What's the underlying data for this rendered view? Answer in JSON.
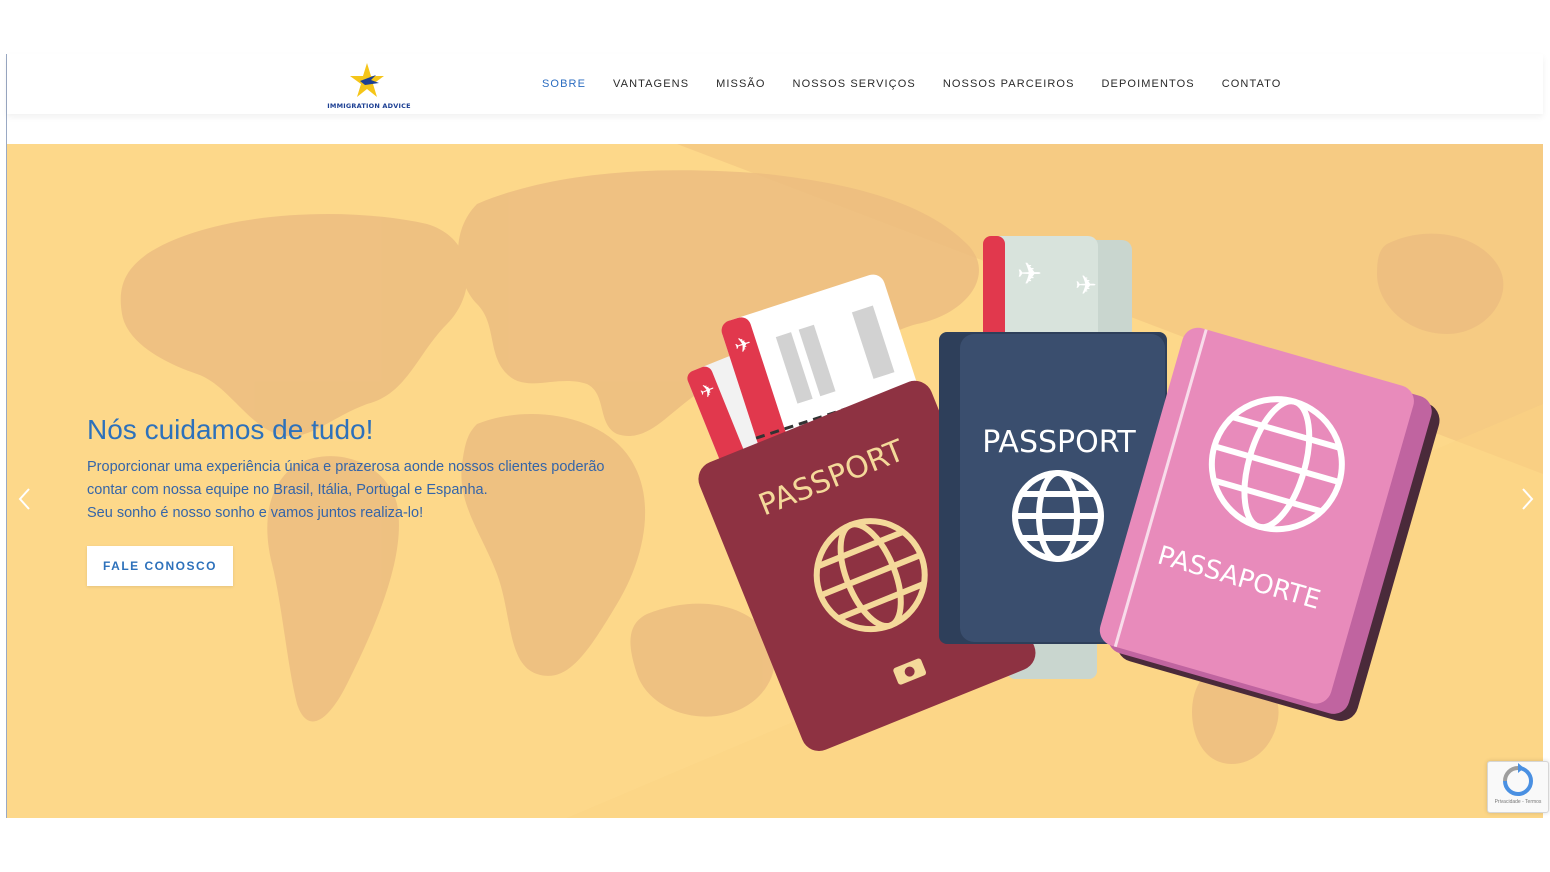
{
  "header": {
    "logo_text": "IMMIGRATION ADVICE",
    "nav": [
      {
        "label": "SOBRE",
        "active": true
      },
      {
        "label": "VANTAGENS",
        "active": false
      },
      {
        "label": "MISSÃO",
        "active": false
      },
      {
        "label": "NOSSOS SERVIÇOS",
        "active": false
      },
      {
        "label": "NOSSOS PARCEIROS",
        "active": false
      },
      {
        "label": "DEPOIMENTOS",
        "active": false
      },
      {
        "label": "CONTATO",
        "active": false
      }
    ]
  },
  "hero": {
    "title": "Nós cuidamos de tudo!",
    "description_lines": [
      "Proporcionar uma experiência única e prazerosa aonde nossos clientes poderão",
      "contar com nossa equipe no Brasil, Itália, Portugal e Espanha.",
      "Seu sonho é nosso sonho e vamos juntos realiza-lo!"
    ],
    "cta_label": "FALE CONOSCO",
    "passport_labels": [
      "PASSPORT",
      "PASSPORT",
      "PASSAPORTE"
    ]
  },
  "recaptcha": {
    "text": "Privacidade - Termos"
  },
  "colors": {
    "accent": "#2d71bb",
    "hero_bg": "#fdd88a",
    "passport_red": "#8e3242",
    "passport_blue": "#3a4e6e",
    "passport_pink": "#e88bbb",
    "logo_star": "#f5c518",
    "logo_text": "#1c3f93"
  },
  "icons": [
    "star-logo-icon",
    "chevron-left-icon",
    "chevron-right-icon",
    "globe-icon",
    "plane-icon",
    "recaptcha-icon"
  ]
}
